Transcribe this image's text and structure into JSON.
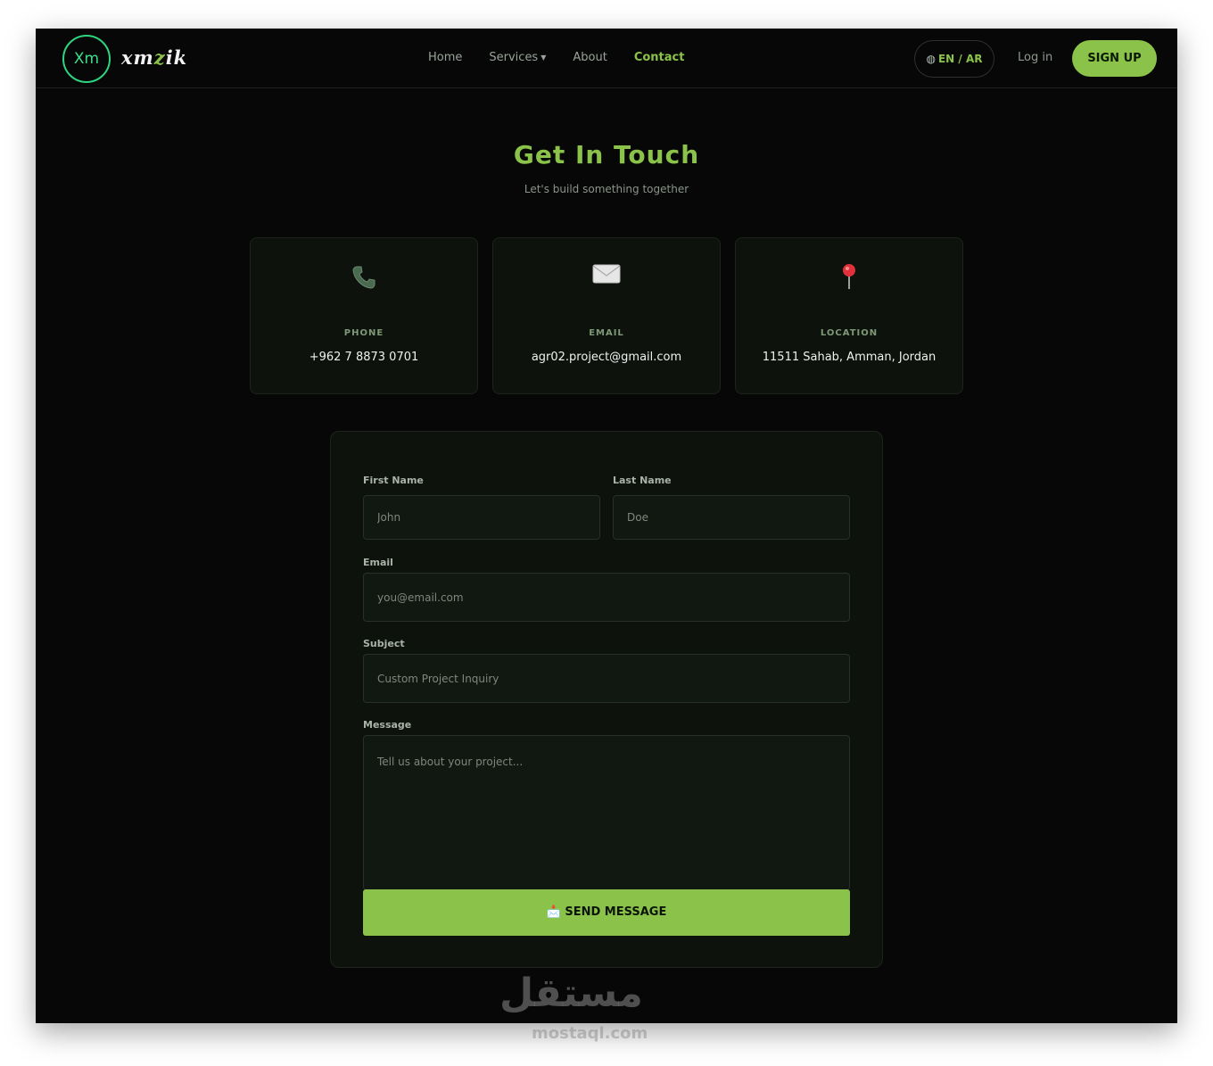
{
  "nav": {
    "logo_mark": "Xm",
    "logo_text_a": "xm",
    "logo_text_b": "z",
    "logo_text_c": "ik",
    "menu": [
      {
        "label": "Home"
      },
      {
        "label": "Services"
      },
      {
        "label": "About"
      },
      {
        "label": "Contact"
      }
    ],
    "lang": "EN / AR",
    "login": "Log in",
    "signup": "SIGN UP"
  },
  "hero": {
    "title": "Get In Touch",
    "subtitle": "Let's build something together"
  },
  "cards": [
    {
      "icon": "phone-icon",
      "label": "PHONE",
      "value": "+962 7 8873 0701"
    },
    {
      "icon": "envelope-icon",
      "label": "EMAIL",
      "value": "agr02.project@gmail.com"
    },
    {
      "icon": "pin-icon",
      "label": "LOCATION",
      "value": "11511 Sahab, Amman, Jordan"
    }
  ],
  "form": {
    "first_name_label": "First Name",
    "first_name_placeholder": "John",
    "last_name_label": "Last Name",
    "last_name_placeholder": "Doe",
    "email_label": "Email",
    "email_placeholder": "you@email.com",
    "subject_label": "Subject",
    "subject_placeholder": "Custom Project Inquiry",
    "message_label": "Message",
    "message_placeholder": "Tell us about your project...",
    "send_label": "SEND MESSAGE"
  },
  "watermark": {
    "arabic": "مستقل",
    "latin": "mostaql.com"
  },
  "colors": {
    "accent": "#8bc34a",
    "background": "#060706",
    "card": "#0d120d",
    "logo_ring": "#2fd47f"
  }
}
